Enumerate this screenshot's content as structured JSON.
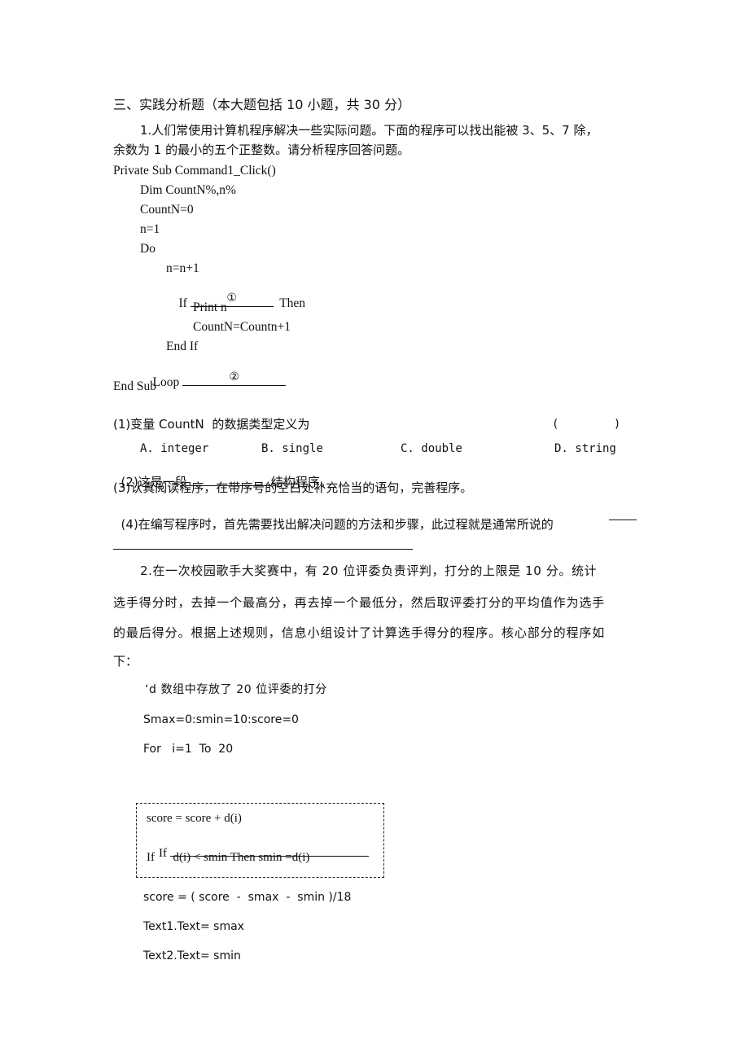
{
  "section": {
    "title": "三、实践分析题（本大题包括 10 小题，共 30 分）"
  },
  "q1": {
    "intro_line1": "1.人们常使用计算机程序解决一些实际问题。下面的程序可以找出能被 3、5、7 除，",
    "intro_line2": "余数为 1 的最小的五个正整数。请分析程序回答问题。",
    "code": {
      "l1": "Private Sub Command1_Click()",
      "l2": "Dim CountN%,n%",
      "l3": "CountN=0",
      "l4": "n=1",
      "l5": "Do",
      "l6": "n=n+1",
      "l7_if": "If",
      "l7_mark": "①",
      "l7_then": "Then",
      "l8": "Print n",
      "l9": "CountN=Countn+1",
      "l10": "End If",
      "l11_loop": "Loop",
      "l11_mark": "②",
      "l12": "End Sub"
    },
    "sub1": {
      "text": "(1)变量 CountN  的数据类型定义为",
      "paren": "(        )",
      "options": [
        "A. integer",
        "B. single",
        "C. double",
        "D. string"
      ]
    },
    "sub2": {
      "prefix": "(2)这是一段",
      "suffix": "结构程序。"
    },
    "sub3": {
      "text": "(3)认真阅读程序，在带序号的空白处补充恰当的语句，完善程序。"
    },
    "sub4": {
      "text": "(4)在编写程序时，首先需要找出解决问题的方法和步骤，此过程就是通常所说的"
    }
  },
  "q2": {
    "para_line1": "2.在一次校园歌手大奖赛中，有 20 位评委负责评判，打分的上限是 10 分。统计",
    "para_line2": "选手得分时，去掉一个最高分，再去掉一个最低分，然后取评委打分的平均值作为选手",
    "para_line3": "的最后得分。根据上述规则，信息小组设计了计算选手得分的程序。核心部分的程序如",
    "para_line4": "下：",
    "code": {
      "comment": "‘d 数组中存放了 20 位评委的打分",
      "init": "Smax=0:smin=10:score=0",
      "for": "For   i=1  To  20",
      "box_l1": "score = score + d(i)",
      "box_l2_if": "If",
      "box_l3": "If      d(i) < smin Then smin =d(i)",
      "after1": "score = ( score  -  smax  -  smin )/18",
      "after2": "Text1.Text= smax",
      "after3": "Text2.Text= smin"
    }
  }
}
